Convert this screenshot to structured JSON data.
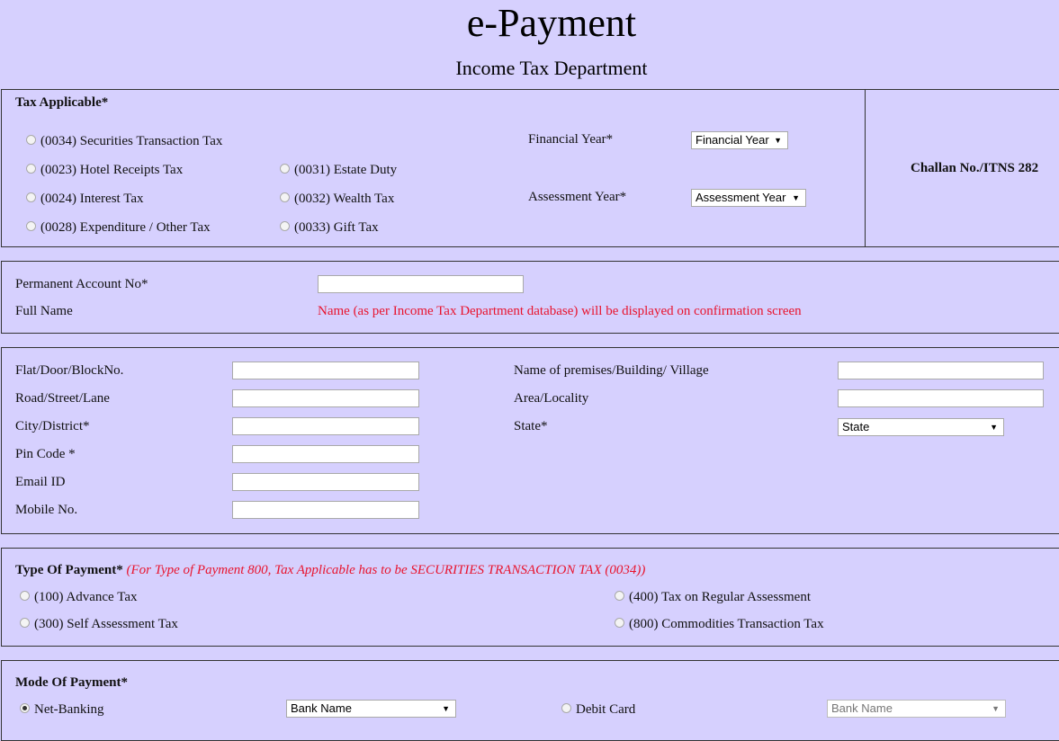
{
  "header": {
    "title": "e-Payment",
    "subtitle": "Income Tax Department"
  },
  "tax_section": {
    "heading": "Tax Applicable*",
    "options": [
      "(0034) Securities Transaction Tax",
      "(0023) Hotel Receipts Tax",
      "(0024) Interest Tax",
      "(0028) Expenditure / Other Tax",
      "(0031) Estate Duty",
      "(0032) Wealth Tax",
      "(0033) Gift Tax"
    ],
    "financial_year_label": "Financial Year*",
    "financial_year_value": "Financial Year",
    "assessment_year_label": "Assessment Year*",
    "assessment_year_value": "Assessment Year",
    "challan": "Challan No./ITNS 282"
  },
  "pan_section": {
    "pan_label": "Permanent Account No*",
    "pan_value": "",
    "name_label": "Full Name",
    "name_note": "Name (as per Income Tax Department database) will be displayed on confirmation screen"
  },
  "address_section": {
    "flat_label": "Flat/Door/BlockNo.",
    "road_label": "Road/Street/Lane",
    "city_label": "City/District*",
    "pin_label": "Pin Code *",
    "email_label": "Email ID",
    "mobile_label": "Mobile No.",
    "premises_label": "Name of premises/Building/ Village",
    "area_label": "Area/Locality",
    "state_label": "State*",
    "state_value": "State"
  },
  "payment_type_section": {
    "heading": "Type Of Payment*",
    "note": "(For Type of Payment 800, Tax Applicable has to be SECURITIES TRANSACTION TAX (0034))",
    "options": [
      "(100) Advance Tax",
      "(300) Self Assessment Tax",
      "(400) Tax on Regular Assessment",
      "(800) Commodities Transaction Tax"
    ]
  },
  "mode_section": {
    "heading": "Mode Of Payment*",
    "net_banking_label": "Net-Banking",
    "net_banking_bank": "Bank Name",
    "debit_card_label": "Debit Card",
    "debit_card_bank": "Bank Name"
  }
}
